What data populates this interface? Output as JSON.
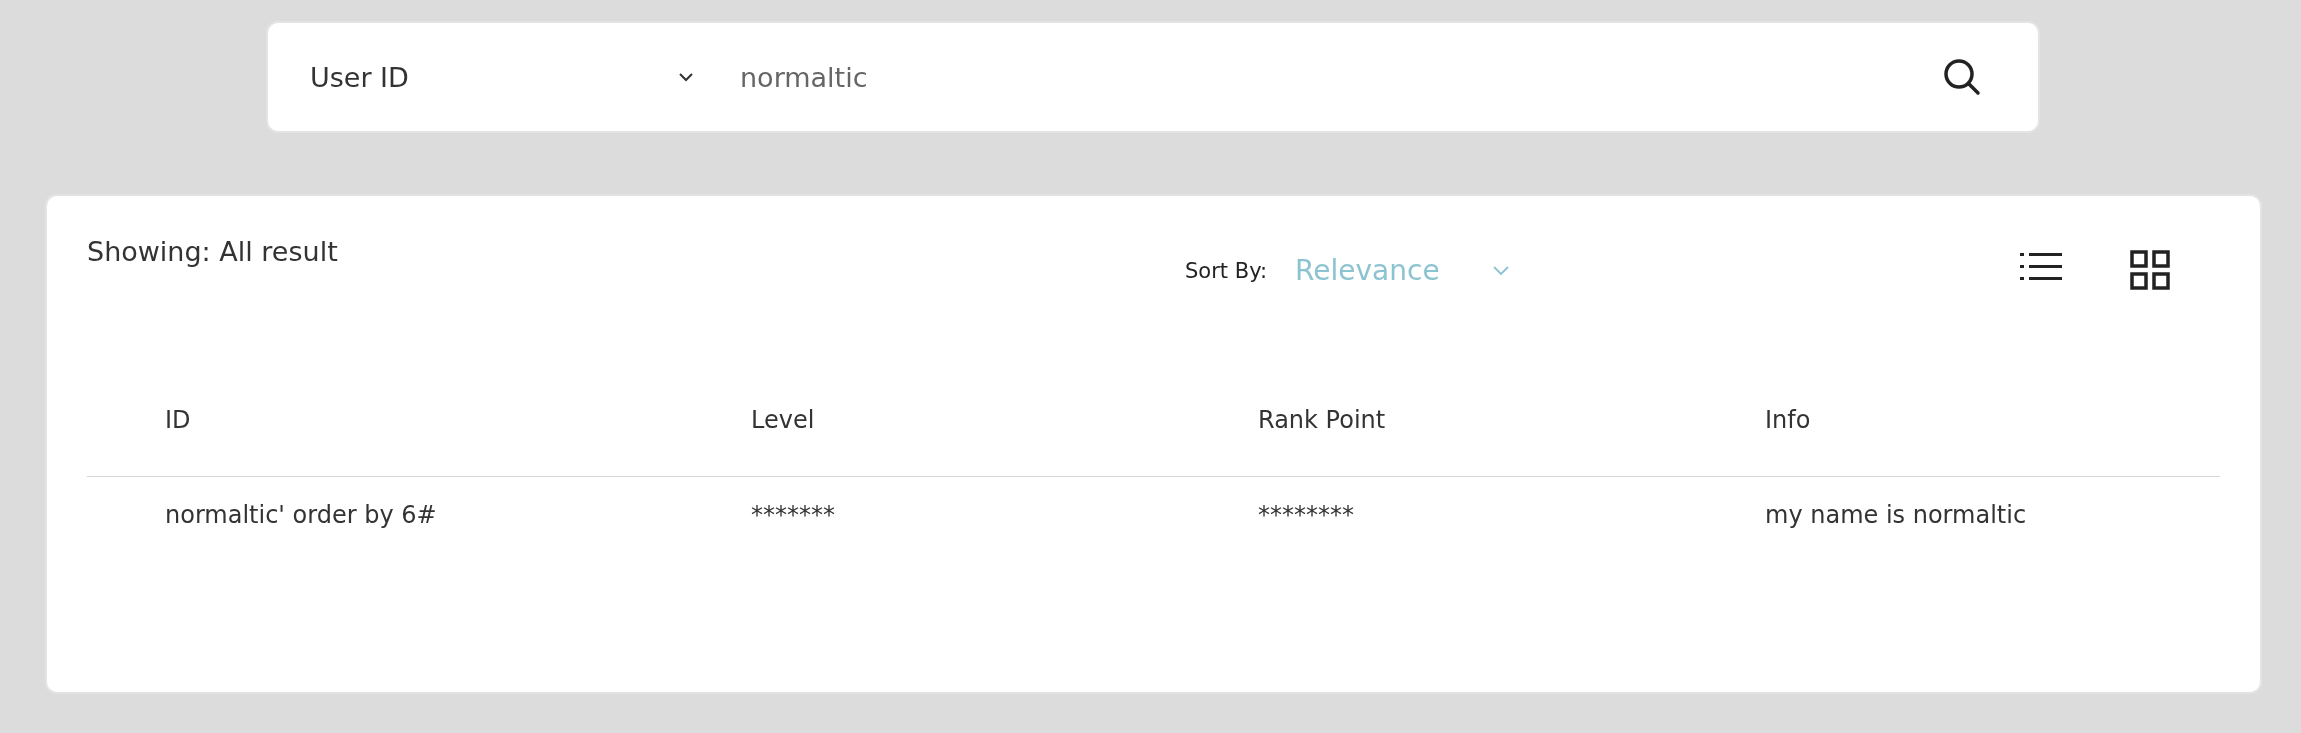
{
  "search": {
    "filter": "User ID",
    "value": "normaltic"
  },
  "results": {
    "showing": "Showing: All result",
    "sort_label": "Sort By:",
    "sort_value": "Relevance",
    "view_modes": [
      {
        "kind": "list",
        "selected": false
      },
      {
        "kind": "grid",
        "selected": false
      }
    ],
    "table": {
      "columns": [
        "ID",
        "Level",
        "Rank Point",
        "Info"
      ],
      "rows": [
        [
          "normaltic' order by 6#",
          "*******",
          "********",
          "my name is normaltic"
        ]
      ]
    }
  }
}
